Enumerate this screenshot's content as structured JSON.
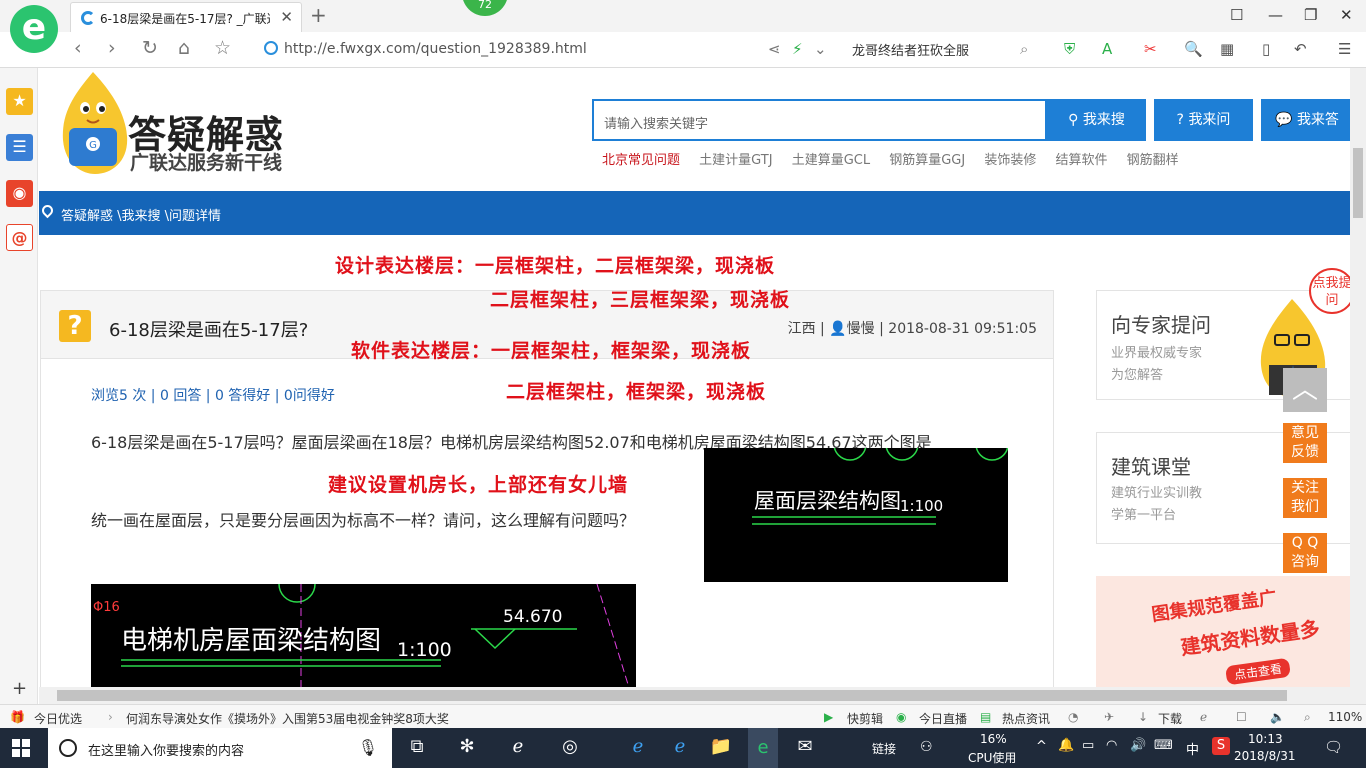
{
  "browser": {
    "tab_title": "6-18层梁是画在5-17层? _广联达",
    "badge": "72",
    "url": "http://e.fwxgx.com/question_1928389.html",
    "search_hint": "龙哥终结者狂砍全服"
  },
  "site": {
    "title": "答疑解惑",
    "subtitle": "广联达服务新干线",
    "search_placeholder": "请输入搜索关键字",
    "btn_search": "我来搜",
    "btn_ask": "我来问",
    "btn_answer": "我来答",
    "quick_links": [
      "北京常见问题",
      "土建计量GTJ",
      "土建算量GCL",
      "钢筋算量GGJ",
      "装饰装修",
      "结算软件",
      "钢筋翻样"
    ],
    "breadcrumb": "答疑解惑 \\我来搜 \\问题详情"
  },
  "annotations": {
    "line1": "设计表达楼层：一层框架柱，二层框架梁，现浇板",
    "line2": "二层框架柱，三层框架梁，现浇板",
    "line3": "软件表达楼层：一层框架柱，框架梁，现浇板",
    "line4": "二层框架柱，框架梁，现浇板",
    "line5": "建议设置机房长，上部还有女儿墙"
  },
  "question": {
    "title": "6-18层梁是画在5-17层?",
    "region": "江西",
    "author": "慢慢",
    "datetime": "2018-08-31 09:51:05",
    "stats": "浏览5 次 | 0 回答 | 0 答得好 | 0问得好",
    "body1": "6-18层梁是画在5-17层吗？屋面层梁画在18层？电梯机房层梁结构图52.07和电梯机房屋面梁结构图54.67这两个图是",
    "body2": "统一画在屋面层，只是要分层画因为标高不一样？请问，这么理解有问题吗？",
    "cad1_title": "屋面层梁结构图",
    "cad1_scale": "1:100",
    "cad2_title": "电梯机房屋面梁结构图",
    "cad2_scale": "1:100",
    "cad2_elev": "54.670",
    "cad2_rebar": "Φ16"
  },
  "sidebar_right": {
    "card1_title": "向专家提问",
    "card1_desc1": "业界最权威专家",
    "card1_desc2": "为您解答",
    "card1_bubble": "点我提问",
    "card2_title": "建筑课堂",
    "card2_desc1": "建筑行业实训教",
    "card2_desc2": "学第一平台",
    "promo1": "图集规范覆盖广",
    "promo2": "建筑资料数量多",
    "promo3": "点击查看",
    "float_feedback1": "意见",
    "float_feedback2": "反馈",
    "float_follow1": "关注",
    "float_follow2": "我们",
    "float_qq1": "Q Q",
    "float_qq2": "咨询"
  },
  "statusbar": {
    "today": "今日优选",
    "news": "何润东导演处女作《摸场外》入围第53届电视金钟奖8项大奖",
    "quick_edit": "快剪辑",
    "live": "今日直播",
    "hot": "热点资讯",
    "download": "下载",
    "zoom": "110%"
  },
  "taskbar": {
    "search_text": "在这里输入你要搜索的内容",
    "link": "链接",
    "cpu_pct": "16%",
    "cpu_label": "CPU使用",
    "ime": "中",
    "time": "10:13",
    "date": "2018/8/31"
  }
}
